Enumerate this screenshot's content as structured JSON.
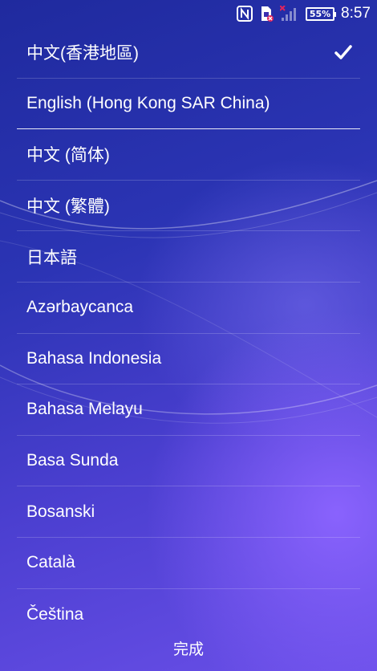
{
  "status_bar": {
    "icons": [
      "nfc-icon",
      "sim-card-error-icon",
      "no-signal-icon"
    ],
    "battery": "55%",
    "time": "8:57"
  },
  "languages": [
    {
      "label": "中文(香港地區)",
      "selected": true
    },
    {
      "label": "English (Hong Kong SAR China)",
      "selected": false
    },
    {
      "label": "中文 (简体)",
      "selected": false
    },
    {
      "label": "中文 (繁體)",
      "selected": false
    },
    {
      "label": "日本語",
      "selected": false
    },
    {
      "label": "Azərbaycanca",
      "selected": false
    },
    {
      "label": "Bahasa Indonesia",
      "selected": false
    },
    {
      "label": "Bahasa Melayu",
      "selected": false
    },
    {
      "label": "Basa Sunda",
      "selected": false
    },
    {
      "label": "Bosanski",
      "selected": false
    },
    {
      "label": "Català",
      "selected": false
    },
    {
      "label": "Čeština",
      "selected": false
    }
  ],
  "footer": {
    "done_label": "完成"
  },
  "colors": {
    "background_top": "#1f2a9e",
    "background_bottom": "#6a4fe8",
    "text": "#ffffff"
  }
}
